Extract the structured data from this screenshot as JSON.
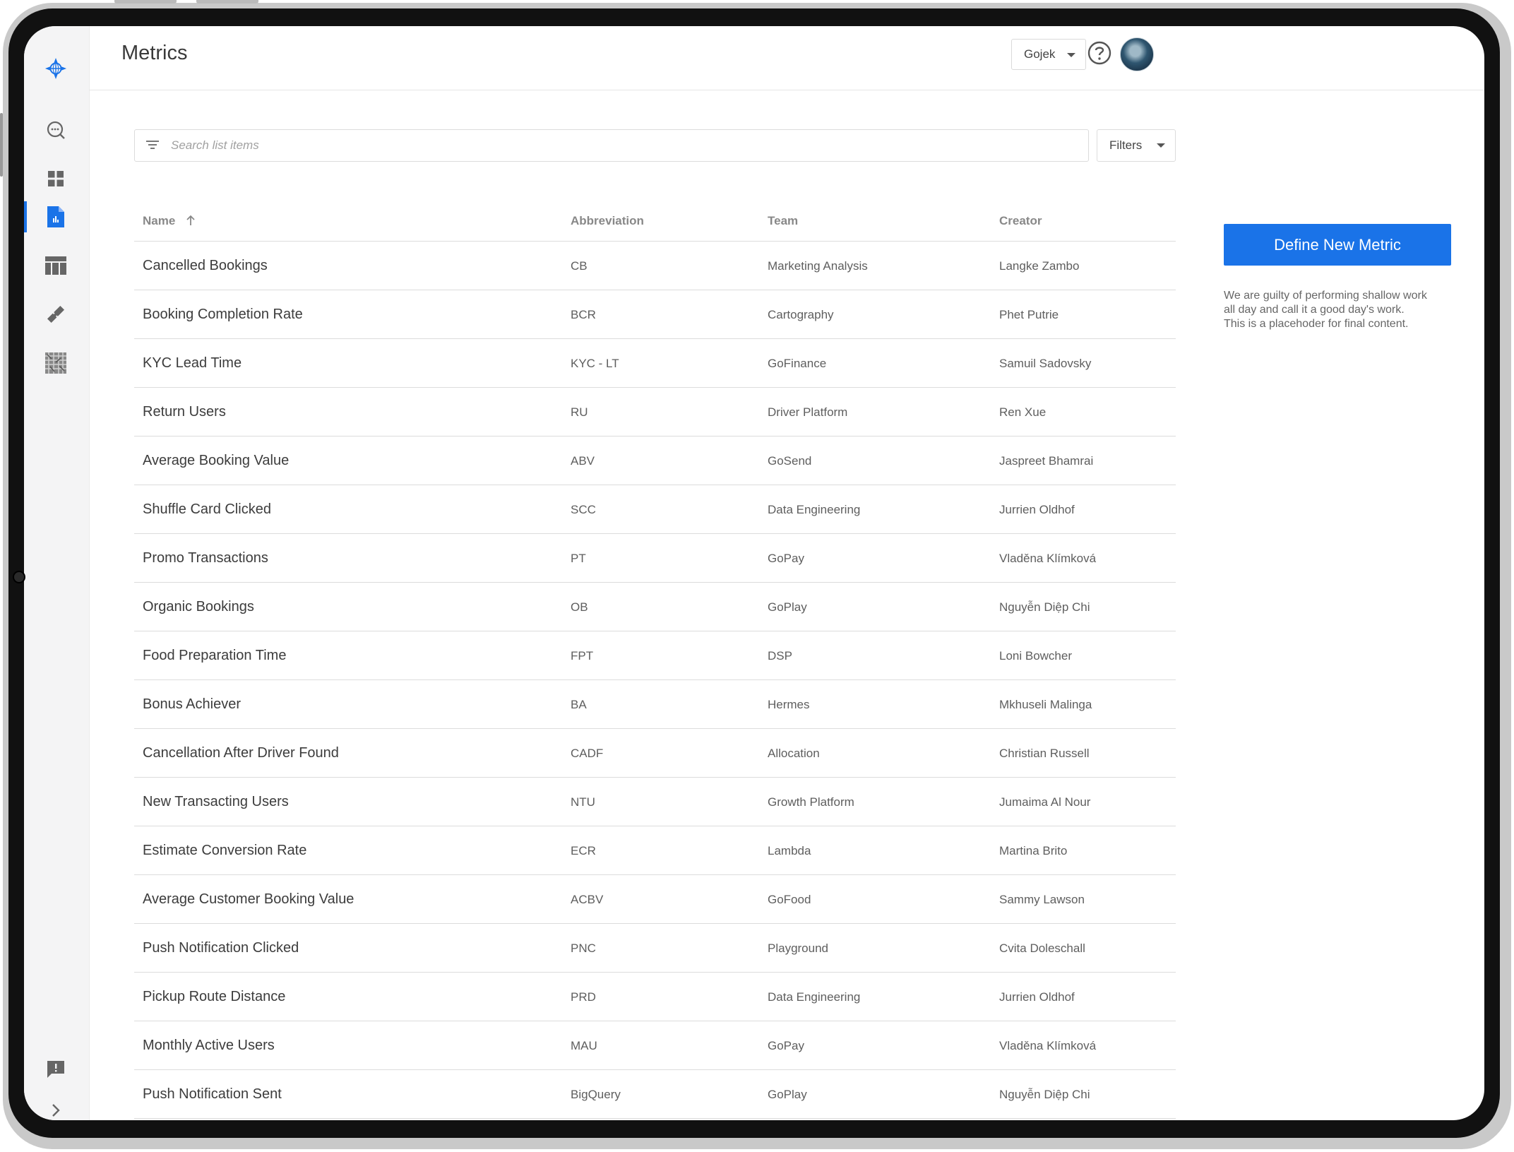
{
  "header": {
    "title": "Metrics",
    "org_select": "Gojek"
  },
  "sidebar": {
    "items": [
      {
        "icon": "explore-search-icon"
      },
      {
        "icon": "dashboard-grid-icon"
      },
      {
        "icon": "metrics-document-icon",
        "active": true
      },
      {
        "icon": "table-icon"
      },
      {
        "icon": "tools-icon"
      },
      {
        "icon": "map-texture-icon"
      }
    ],
    "footer": [
      {
        "icon": "feedback-icon"
      },
      {
        "icon": "expand-chevron-icon"
      }
    ]
  },
  "search": {
    "placeholder": "Search list items",
    "filters_label": "Filters"
  },
  "table": {
    "columns": {
      "name": "Name",
      "abbreviation": "Abbreviation",
      "team": "Team",
      "creator": "Creator"
    },
    "rows": [
      {
        "name": "Cancelled Bookings",
        "abbr": "CB",
        "team": "Marketing Analysis",
        "creator": "Langke Zambo"
      },
      {
        "name": "Booking Completion Rate",
        "abbr": "BCR",
        "team": "Cartography",
        "creator": "Phet Putrie"
      },
      {
        "name": "KYC Lead Time",
        "abbr": "KYC - LT",
        "team": "GoFinance",
        "creator": "Samuil Sadovsky"
      },
      {
        "name": "Return Users",
        "abbr": "RU",
        "team": "Driver Platform",
        "creator": "Ren Xue"
      },
      {
        "name": "Average Booking Value",
        "abbr": "ABV",
        "team": "GoSend",
        "creator": "Jaspreet Bhamrai"
      },
      {
        "name": "Shuffle Card Clicked",
        "abbr": "SCC",
        "team": "Data Engineering",
        "creator": "Jurrien Oldhof"
      },
      {
        "name": "Promo Transactions",
        "abbr": "PT",
        "team": "GoPay",
        "creator": "Vladěna Klímková"
      },
      {
        "name": "Organic Bookings",
        "abbr": "OB",
        "team": "GoPlay",
        "creator": "Nguyễn Diệp Chi"
      },
      {
        "name": "Food Preparation Time",
        "abbr": "FPT",
        "team": "DSP",
        "creator": "Loni Bowcher"
      },
      {
        "name": "Bonus Achiever",
        "abbr": "BA",
        "team": "Hermes",
        "creator": "Mkhuseli Malinga"
      },
      {
        "name": "Cancellation After Driver Found",
        "abbr": "CADF",
        "team": "Allocation",
        "creator": "Christian Russell"
      },
      {
        "name": "New Transacting Users",
        "abbr": "NTU",
        "team": "Growth Platform",
        "creator": "Jumaima Al Nour"
      },
      {
        "name": "Estimate Conversion Rate",
        "abbr": "ECR",
        "team": "Lambda",
        "creator": "Martina Brito"
      },
      {
        "name": "Average Customer Booking Value",
        "abbr": "ACBV",
        "team": "GoFood",
        "creator": "Sammy Lawson"
      },
      {
        "name": "Push Notification Clicked",
        "abbr": "PNC",
        "team": "Playground",
        "creator": "Cvita Doleschall"
      },
      {
        "name": "Pickup Route Distance",
        "abbr": "PRD",
        "team": "Data Engineering",
        "creator": "Jurrien Oldhof"
      },
      {
        "name": "Monthly Active Users",
        "abbr": "MAU",
        "team": "GoPay",
        "creator": "Vladěna Klímková"
      },
      {
        "name": "Push Notification Sent",
        "abbr": "BigQuery",
        "team": "GoPlay",
        "creator": "Nguyễn Diệp Chi"
      }
    ]
  },
  "aside": {
    "define_button": "Define New Metric",
    "description_lines": [
      "We are guilty of performing shallow work",
      "all day and call it a good day's work.",
      "This is a placehoder for final content."
    ]
  },
  "colors": {
    "accent": "#1a73e8",
    "sidebar_bg": "#f4f4f5"
  }
}
